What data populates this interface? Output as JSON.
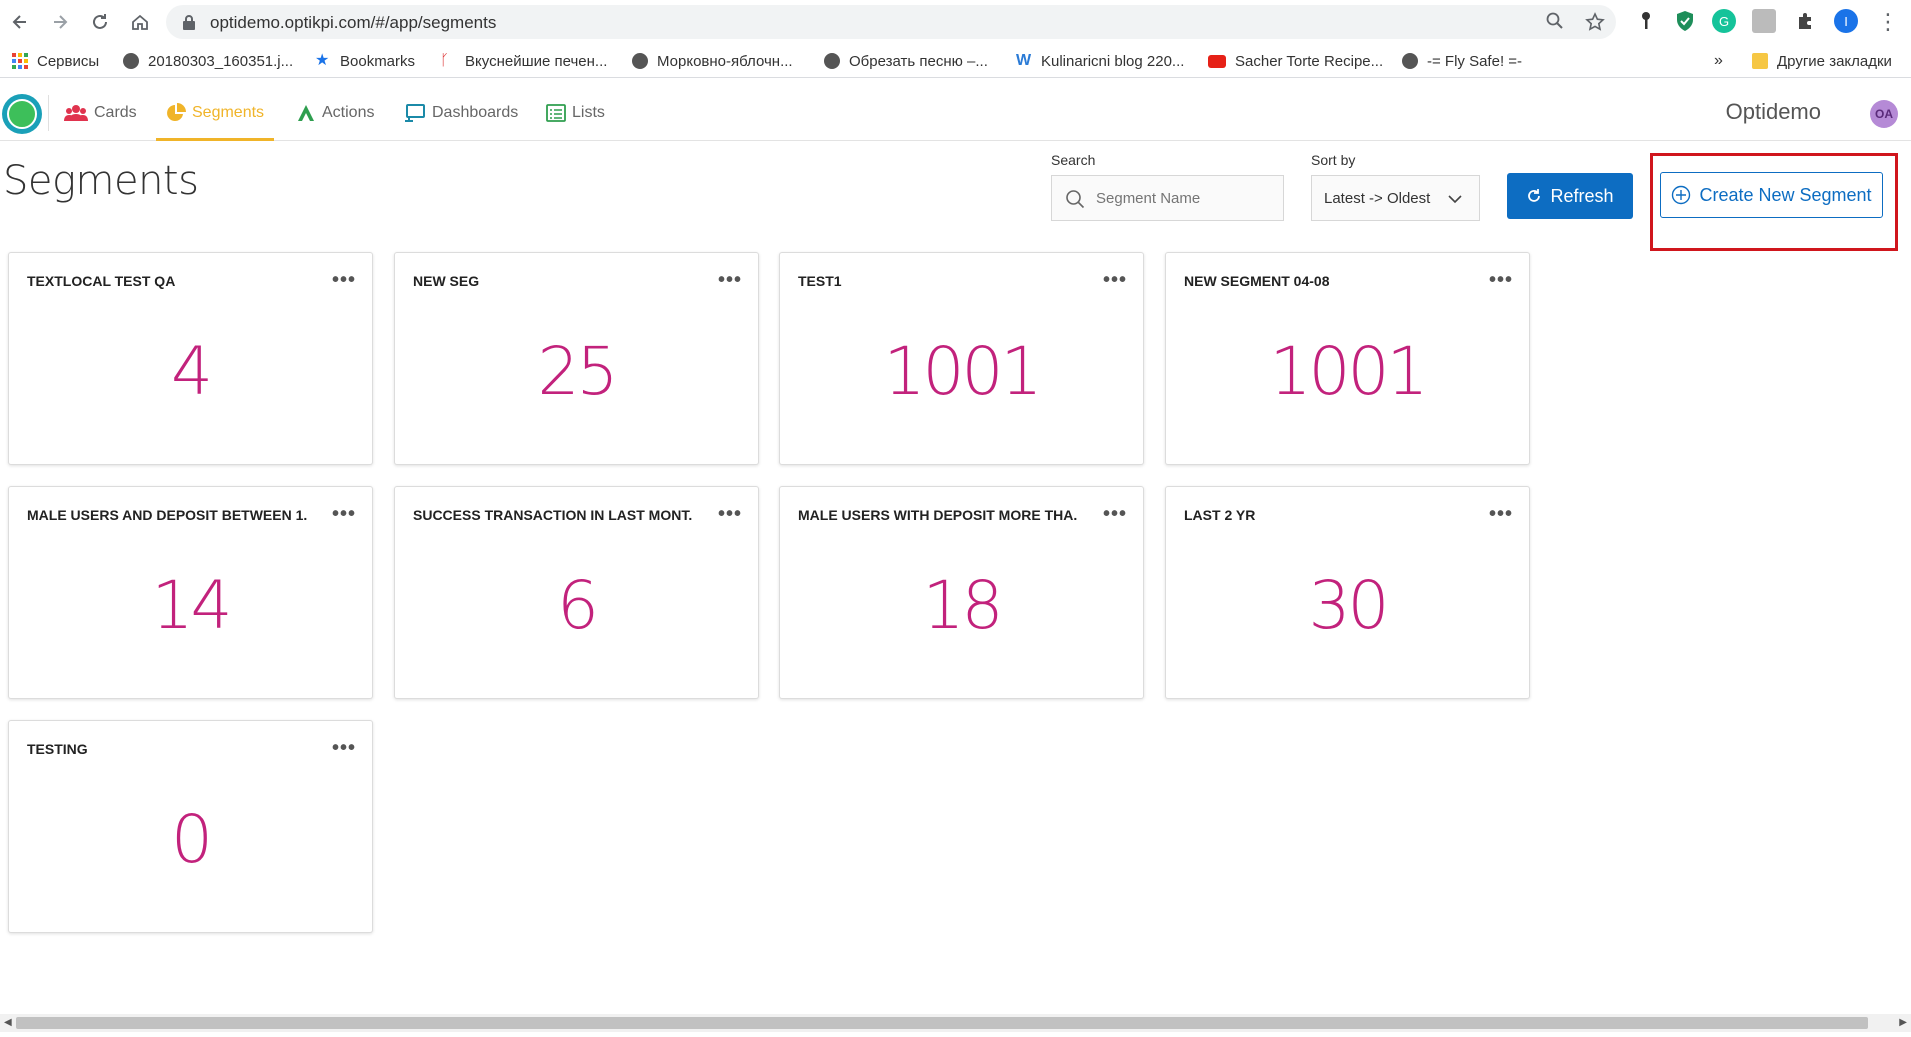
{
  "browser": {
    "url": "optidemo.optikpi.com/#/app/segments",
    "bookmarks": [
      "Сервисы",
      "20180303_160351.j...",
      "Bookmarks",
      "Вкуснейшие печен...",
      "Морковно-яблочн...",
      "Обрезать песню –...",
      "Kulinaricni blog 220...",
      "Sacher Torte Recipe...",
      "-= Fly Safe! =-"
    ],
    "overflow": "»",
    "other_bookmarks": "Другие закладки",
    "profile_initial": "I"
  },
  "header": {
    "tabs": [
      "Cards",
      "Segments",
      "Actions",
      "Dashboards",
      "Lists"
    ],
    "active_tab": "Segments",
    "app_name": "Optidemo",
    "avatar": "OA",
    "accent": "#f0b429"
  },
  "page": {
    "title": "Segments",
    "search_label": "Search",
    "search_placeholder": "Segment Name",
    "sort_label": "Sort by",
    "sort_value": "Latest -> Oldest",
    "refresh_label": "Refresh",
    "create_label": "Create New Segment",
    "primary_color": "#0d6dc2",
    "value_color": "#c2227c"
  },
  "segments": [
    {
      "name": "TEXTLOCAL TEST QA",
      "count": "4"
    },
    {
      "name": "NEW SEG",
      "count": "25"
    },
    {
      "name": "TEST1",
      "count": "1001"
    },
    {
      "name": "NEW SEGMENT 04-08",
      "count": "1001"
    },
    {
      "name": "MALE USERS AND DEPOSIT BETWEEN 1...",
      "count": "14"
    },
    {
      "name": "SUCCESS TRANSACTION IN LAST MONT...",
      "count": "6"
    },
    {
      "name": "MALE USERS WITH DEPOSIT MORE THA...",
      "count": "18"
    },
    {
      "name": "LAST 2 YR",
      "count": "30"
    },
    {
      "name": "TESTING",
      "count": "0"
    }
  ]
}
